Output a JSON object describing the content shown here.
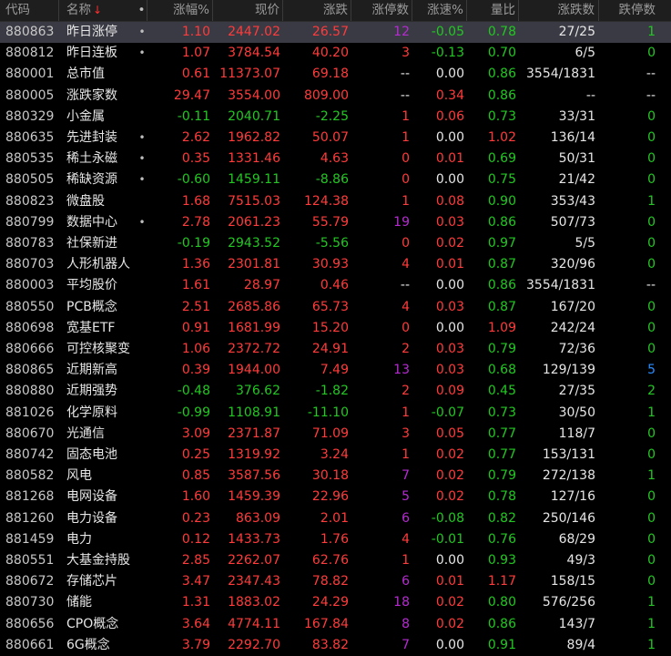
{
  "columns": {
    "code": "代码",
    "name": "名称",
    "sort_arrow": "↓",
    "col_menu": "•",
    "pct": "涨幅%",
    "price": "现价",
    "chg": "涨跌",
    "zt": "涨停数",
    "speed": "涨速%",
    "lb": "量比",
    "zds": "涨跌数",
    "dt": "跌停数"
  },
  "rows": [
    {
      "code": "880863",
      "name": "昨日涨停",
      "mark": "•",
      "pct": "1.10",
      "price": "2447.02",
      "chg": "26.57",
      "zt": "12",
      "speed": "-0.05",
      "lb": "0.78",
      "zds": "27/25",
      "dt": "1",
      "pct_c": "up",
      "price_c": "up",
      "chg_c": "up",
      "zt_c": "pu",
      "speed_c": "dn",
      "lb_c": "dn",
      "dt_c": "dn"
    },
    {
      "code": "880812",
      "name": "昨日连板",
      "mark": "•",
      "pct": "1.07",
      "price": "3784.54",
      "chg": "40.20",
      "zt": "3",
      "speed": "-0.13",
      "lb": "0.70",
      "zds": "6/5",
      "dt": "0",
      "pct_c": "up",
      "price_c": "up",
      "chg_c": "up",
      "zt_c": "up",
      "speed_c": "dn",
      "lb_c": "dn",
      "dt_c": "dn"
    },
    {
      "code": "880001",
      "name": "总市值",
      "mark": "",
      "pct": "0.61",
      "price": "11373.07",
      "chg": "69.18",
      "zt": "--",
      "speed": "0.00",
      "lb": "0.86",
      "zds": "3554/1831",
      "dt": "--",
      "pct_c": "up",
      "price_c": "up",
      "chg_c": "up",
      "zt_c": "ne",
      "speed_c": "ne",
      "lb_c": "dn",
      "dt_c": "ne"
    },
    {
      "code": "880005",
      "name": "涨跌家数",
      "mark": "",
      "pct": "29.47",
      "price": "3554.00",
      "chg": "809.00",
      "zt": "--",
      "speed": "0.34",
      "lb": "0.86",
      "zds": "--",
      "dt": "--",
      "pct_c": "up",
      "price_c": "up",
      "chg_c": "up",
      "zt_c": "ne",
      "speed_c": "up",
      "lb_c": "dn",
      "dt_c": "ne"
    },
    {
      "code": "880329",
      "name": "小金属",
      "mark": "",
      "pct": "-0.11",
      "price": "2040.71",
      "chg": "-2.25",
      "zt": "1",
      "speed": "0.06",
      "lb": "0.73",
      "zds": "33/31",
      "dt": "0",
      "pct_c": "dn",
      "price_c": "dn",
      "chg_c": "dn",
      "zt_c": "up",
      "speed_c": "up",
      "lb_c": "dn",
      "dt_c": "dn"
    },
    {
      "code": "880635",
      "name": "先进封装",
      "mark": "•",
      "pct": "2.62",
      "price": "1962.82",
      "chg": "50.07",
      "zt": "1",
      "speed": "0.00",
      "lb": "1.02",
      "zds": "136/14",
      "dt": "0",
      "pct_c": "up",
      "price_c": "up",
      "chg_c": "up",
      "zt_c": "up",
      "speed_c": "ne",
      "lb_c": "up",
      "dt_c": "dn"
    },
    {
      "code": "880535",
      "name": "稀土永磁",
      "mark": "•",
      "pct": "0.35",
      "price": "1331.46",
      "chg": "4.63",
      "zt": "0",
      "speed": "0.01",
      "lb": "0.69",
      "zds": "50/31",
      "dt": "0",
      "pct_c": "up",
      "price_c": "up",
      "chg_c": "up",
      "zt_c": "up",
      "speed_c": "up",
      "lb_c": "dn",
      "dt_c": "dn"
    },
    {
      "code": "880505",
      "name": "稀缺资源",
      "mark": "•",
      "pct": "-0.60",
      "price": "1459.11",
      "chg": "-8.86",
      "zt": "0",
      "speed": "0.00",
      "lb": "0.75",
      "zds": "21/42",
      "dt": "0",
      "pct_c": "dn",
      "price_c": "dn",
      "chg_c": "dn",
      "zt_c": "up",
      "speed_c": "ne",
      "lb_c": "dn",
      "dt_c": "dn"
    },
    {
      "code": "880823",
      "name": "微盘股",
      "mark": "",
      "pct": "1.68",
      "price": "7515.03",
      "chg": "124.38",
      "zt": "1",
      "speed": "0.08",
      "lb": "0.90",
      "zds": "353/43",
      "dt": "1",
      "pct_c": "up",
      "price_c": "up",
      "chg_c": "up",
      "zt_c": "up",
      "speed_c": "up",
      "lb_c": "dn",
      "dt_c": "dn"
    },
    {
      "code": "880799",
      "name": "数据中心",
      "mark": "•",
      "pct": "2.78",
      "price": "2061.23",
      "chg": "55.79",
      "zt": "19",
      "speed": "0.03",
      "lb": "0.86",
      "zds": "507/73",
      "dt": "0",
      "pct_c": "up",
      "price_c": "up",
      "chg_c": "up",
      "zt_c": "pu",
      "speed_c": "up",
      "lb_c": "dn",
      "dt_c": "dn"
    },
    {
      "code": "880783",
      "name": "社保新进",
      "mark": "",
      "pct": "-0.19",
      "price": "2943.52",
      "chg": "-5.56",
      "zt": "0",
      "speed": "0.02",
      "lb": "0.97",
      "zds": "5/5",
      "dt": "0",
      "pct_c": "dn",
      "price_c": "dn",
      "chg_c": "dn",
      "zt_c": "up",
      "speed_c": "up",
      "lb_c": "dn",
      "dt_c": "dn"
    },
    {
      "code": "880703",
      "name": "人形机器人",
      "mark": "",
      "pct": "1.36",
      "price": "2301.81",
      "chg": "30.93",
      "zt": "4",
      "speed": "0.01",
      "lb": "0.87",
      "zds": "320/96",
      "dt": "0",
      "pct_c": "up",
      "price_c": "up",
      "chg_c": "up",
      "zt_c": "up",
      "speed_c": "up",
      "lb_c": "dn",
      "dt_c": "dn"
    },
    {
      "code": "880003",
      "name": "平均股价",
      "mark": "",
      "pct": "1.61",
      "price": "28.97",
      "chg": "0.46",
      "zt": "--",
      "speed": "0.00",
      "lb": "0.86",
      "zds": "3554/1831",
      "dt": "--",
      "pct_c": "up",
      "price_c": "up",
      "chg_c": "up",
      "zt_c": "ne",
      "speed_c": "ne",
      "lb_c": "dn",
      "dt_c": "ne"
    },
    {
      "code": "880550",
      "name": "PCB概念",
      "mark": "",
      "pct": "2.51",
      "price": "2685.86",
      "chg": "65.73",
      "zt": "4",
      "speed": "0.03",
      "lb": "0.87",
      "zds": "167/20",
      "dt": "0",
      "pct_c": "up",
      "price_c": "up",
      "chg_c": "up",
      "zt_c": "up",
      "speed_c": "up",
      "lb_c": "dn",
      "dt_c": "dn"
    },
    {
      "code": "880698",
      "name": "宽基ETF",
      "mark": "",
      "pct": "0.91",
      "price": "1681.99",
      "chg": "15.20",
      "zt": "0",
      "speed": "0.00",
      "lb": "1.09",
      "zds": "242/24",
      "dt": "0",
      "pct_c": "up",
      "price_c": "up",
      "chg_c": "up",
      "zt_c": "up",
      "speed_c": "ne",
      "lb_c": "up",
      "dt_c": "dn"
    },
    {
      "code": "880666",
      "name": "可控核聚变",
      "mark": "",
      "pct": "1.06",
      "price": "2372.72",
      "chg": "24.91",
      "zt": "2",
      "speed": "0.03",
      "lb": "0.79",
      "zds": "72/36",
      "dt": "0",
      "pct_c": "up",
      "price_c": "up",
      "chg_c": "up",
      "zt_c": "up",
      "speed_c": "up",
      "lb_c": "dn",
      "dt_c": "dn"
    },
    {
      "code": "880865",
      "name": "近期新高",
      "mark": "",
      "pct": "0.39",
      "price": "1944.00",
      "chg": "7.49",
      "zt": "13",
      "speed": "0.03",
      "lb": "0.68",
      "zds": "129/139",
      "dt": "5",
      "pct_c": "up",
      "price_c": "up",
      "chg_c": "up",
      "zt_c": "pu",
      "speed_c": "up",
      "lb_c": "dn",
      "dt_c": "bl"
    },
    {
      "code": "880880",
      "name": "近期强势",
      "mark": "",
      "pct": "-0.48",
      "price": "376.62",
      "chg": "-1.82",
      "zt": "2",
      "speed": "0.09",
      "lb": "0.45",
      "zds": "27/35",
      "dt": "2",
      "pct_c": "dn",
      "price_c": "dn",
      "chg_c": "dn",
      "zt_c": "up",
      "speed_c": "up",
      "lb_c": "dn",
      "dt_c": "dn"
    },
    {
      "code": "881026",
      "name": "化学原料",
      "mark": "",
      "pct": "-0.99",
      "price": "1108.91",
      "chg": "-11.10",
      "zt": "1",
      "speed": "-0.07",
      "lb": "0.73",
      "zds": "30/50",
      "dt": "1",
      "pct_c": "dn",
      "price_c": "dn",
      "chg_c": "dn",
      "zt_c": "up",
      "speed_c": "dn",
      "lb_c": "dn",
      "dt_c": "dn"
    },
    {
      "code": "880670",
      "name": "光通信",
      "mark": "",
      "pct": "3.09",
      "price": "2371.87",
      "chg": "71.09",
      "zt": "3",
      "speed": "0.05",
      "lb": "0.77",
      "zds": "118/7",
      "dt": "0",
      "pct_c": "up",
      "price_c": "up",
      "chg_c": "up",
      "zt_c": "up",
      "speed_c": "up",
      "lb_c": "dn",
      "dt_c": "dn"
    },
    {
      "code": "880742",
      "name": "固态电池",
      "mark": "",
      "pct": "0.25",
      "price": "1319.92",
      "chg": "3.24",
      "zt": "1",
      "speed": "0.02",
      "lb": "0.77",
      "zds": "153/131",
      "dt": "0",
      "pct_c": "up",
      "price_c": "up",
      "chg_c": "up",
      "zt_c": "up",
      "speed_c": "up",
      "lb_c": "dn",
      "dt_c": "dn"
    },
    {
      "code": "880582",
      "name": "风电",
      "mark": "",
      "pct": "0.85",
      "price": "3587.56",
      "chg": "30.18",
      "zt": "7",
      "speed": "0.02",
      "lb": "0.79",
      "zds": "272/138",
      "dt": "1",
      "pct_c": "up",
      "price_c": "up",
      "chg_c": "up",
      "zt_c": "pu",
      "speed_c": "up",
      "lb_c": "dn",
      "dt_c": "dn"
    },
    {
      "code": "881268",
      "name": "电网设备",
      "mark": "",
      "pct": "1.60",
      "price": "1459.39",
      "chg": "22.96",
      "zt": "5",
      "speed": "0.02",
      "lb": "0.78",
      "zds": "127/16",
      "dt": "0",
      "pct_c": "up",
      "price_c": "up",
      "chg_c": "up",
      "zt_c": "pu",
      "speed_c": "up",
      "lb_c": "dn",
      "dt_c": "dn"
    },
    {
      "code": "881260",
      "name": "电力设备",
      "mark": "",
      "pct": "0.23",
      "price": "863.09",
      "chg": "2.01",
      "zt": "6",
      "speed": "-0.08",
      "lb": "0.82",
      "zds": "250/146",
      "dt": "0",
      "pct_c": "up",
      "price_c": "up",
      "chg_c": "up",
      "zt_c": "pu",
      "speed_c": "dn",
      "lb_c": "dn",
      "dt_c": "dn"
    },
    {
      "code": "881459",
      "name": "电力",
      "mark": "",
      "pct": "0.12",
      "price": "1433.73",
      "chg": "1.76",
      "zt": "4",
      "speed": "-0.01",
      "lb": "0.76",
      "zds": "68/29",
      "dt": "0",
      "pct_c": "up",
      "price_c": "up",
      "chg_c": "up",
      "zt_c": "up",
      "speed_c": "dn",
      "lb_c": "dn",
      "dt_c": "dn"
    },
    {
      "code": "880551",
      "name": "大基金持股",
      "mark": "",
      "pct": "2.85",
      "price": "2262.07",
      "chg": "62.76",
      "zt": "1",
      "speed": "0.00",
      "lb": "0.93",
      "zds": "49/3",
      "dt": "0",
      "pct_c": "up",
      "price_c": "up",
      "chg_c": "up",
      "zt_c": "up",
      "speed_c": "ne",
      "lb_c": "dn",
      "dt_c": "dn"
    },
    {
      "code": "880672",
      "name": "存储芯片",
      "mark": "",
      "pct": "3.47",
      "price": "2347.43",
      "chg": "78.82",
      "zt": "6",
      "speed": "0.01",
      "lb": "1.17",
      "zds": "158/15",
      "dt": "0",
      "pct_c": "up",
      "price_c": "up",
      "chg_c": "up",
      "zt_c": "pu",
      "speed_c": "up",
      "lb_c": "up",
      "dt_c": "dn"
    },
    {
      "code": "880730",
      "name": "储能",
      "mark": "",
      "pct": "1.31",
      "price": "1883.02",
      "chg": "24.29",
      "zt": "18",
      "speed": "0.02",
      "lb": "0.80",
      "zds": "576/256",
      "dt": "1",
      "pct_c": "up",
      "price_c": "up",
      "chg_c": "up",
      "zt_c": "pu",
      "speed_c": "up",
      "lb_c": "dn",
      "dt_c": "dn"
    },
    {
      "code": "880656",
      "name": "CPO概念",
      "mark": "",
      "pct": "3.64",
      "price": "4774.11",
      "chg": "167.84",
      "zt": "8",
      "speed": "0.02",
      "lb": "0.86",
      "zds": "143/7",
      "dt": "1",
      "pct_c": "up",
      "price_c": "up",
      "chg_c": "up",
      "zt_c": "pu",
      "speed_c": "up",
      "lb_c": "dn",
      "dt_c": "dn"
    },
    {
      "code": "880661",
      "name": "6G概念",
      "mark": "",
      "pct": "3.79",
      "price": "2292.70",
      "chg": "83.82",
      "zt": "7",
      "speed": "0.00",
      "lb": "0.91",
      "zds": "89/4",
      "dt": "1",
      "pct_c": "up",
      "price_c": "up",
      "chg_c": "up",
      "zt_c": "pu",
      "speed_c": "ne",
      "lb_c": "dn",
      "dt_c": "dn"
    }
  ],
  "selected_row": 0,
  "colors": {
    "up": "#ff3b3b",
    "down": "#22c722",
    "neutral": "#e6e6e6",
    "limit_purple": "#b52bd1",
    "blue": "#2a8cff",
    "background": "#000000",
    "header_bg": "#1e1e1e",
    "selected_bg": "#3a3a44"
  }
}
